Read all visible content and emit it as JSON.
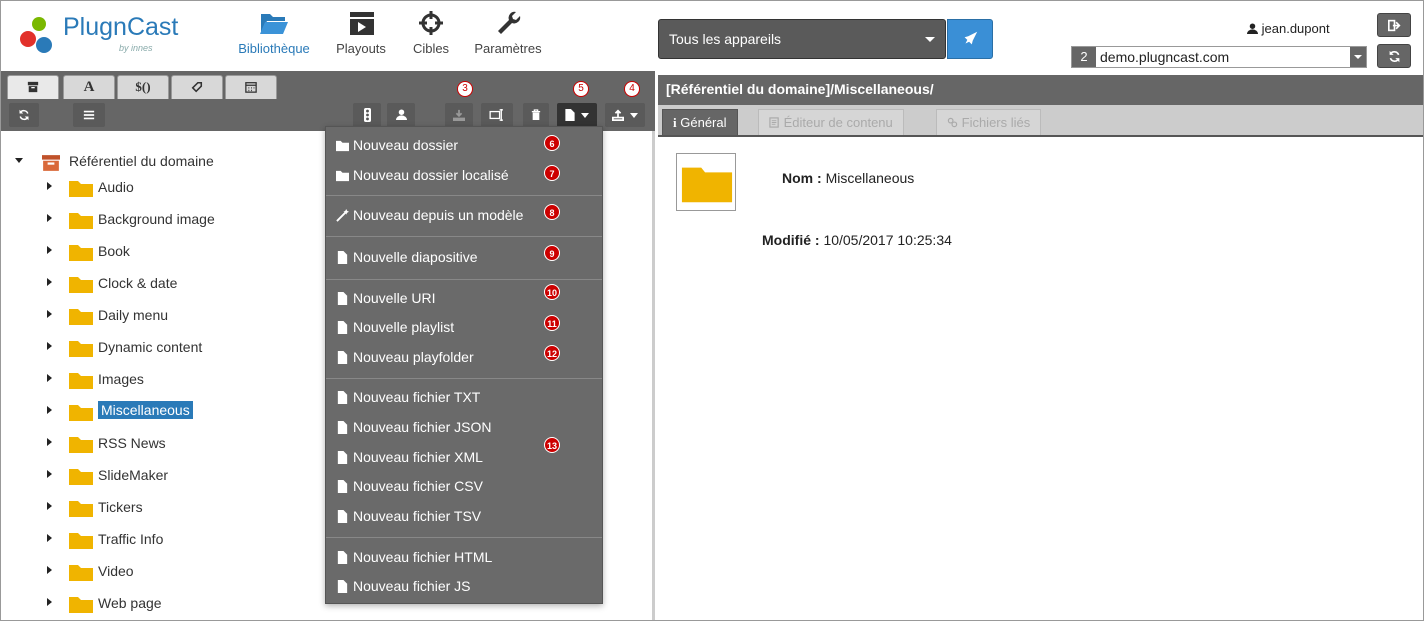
{
  "header": {
    "logo_name": "PlugnCast",
    "logo_by": "by innes",
    "nav": [
      {
        "label": "Bibliothèque",
        "icon": "folder-open-icon",
        "active": true
      },
      {
        "label": "Playouts",
        "icon": "clapperboard-icon",
        "active": false
      },
      {
        "label": "Cibles",
        "icon": "crosshair-icon",
        "active": false
      },
      {
        "label": "Paramètres",
        "icon": "wrench-icon",
        "active": false
      }
    ],
    "device_select": "Tous les appareils",
    "user": "jean.dupont",
    "domain_number": "2",
    "domain_value": "demo.plugncast.com"
  },
  "left": {
    "tabs": [
      {
        "label": "",
        "icon": "archive-icon"
      },
      {
        "label": "A",
        "icon": "font-icon"
      },
      {
        "label": "$()",
        "icon": "variable-icon"
      },
      {
        "label": "",
        "icon": "tag-icon"
      },
      {
        "label": "",
        "icon": "calendar-icon"
      }
    ],
    "markers": [
      "3",
      "5",
      "4"
    ],
    "tree_root": "Référentiel du domaine",
    "tree_items": [
      "Audio",
      "Background image",
      "Book",
      "Clock & date",
      "Daily menu",
      "Dynamic content",
      "Images",
      "Miscellaneous",
      "RSS News",
      "SlideMaker",
      "Tickers",
      "Traffic Info",
      "Video",
      "Web page"
    ],
    "selected_item": "Miscellaneous"
  },
  "menu": {
    "items": [
      {
        "label": "Nouveau dossier",
        "icon": "folder-icon",
        "marker": "6"
      },
      {
        "label": "Nouveau dossier localisé",
        "icon": "folder-icon",
        "marker": "7"
      },
      {
        "label": "Nouveau depuis un modèle",
        "icon": "magic-wand-icon",
        "marker": "8"
      },
      {
        "label": "Nouvelle diapositive",
        "icon": "file-icon",
        "marker": "9"
      },
      {
        "label": "Nouvelle URI",
        "icon": "file-icon",
        "marker": "10"
      },
      {
        "label": "Nouvelle playlist",
        "icon": "file-icon",
        "marker": "11"
      },
      {
        "label": "Nouveau playfolder",
        "icon": "file-icon",
        "marker": "12"
      },
      {
        "label": "Nouveau fichier TXT",
        "icon": "file-icon"
      },
      {
        "label": "Nouveau fichier JSON",
        "icon": "file-icon",
        "marker": "13"
      },
      {
        "label": "Nouveau fichier XML",
        "icon": "file-icon"
      },
      {
        "label": "Nouveau fichier CSV",
        "icon": "file-icon"
      },
      {
        "label": "Nouveau fichier TSV",
        "icon": "file-icon"
      },
      {
        "label": "Nouveau fichier HTML",
        "icon": "file-icon"
      },
      {
        "label": "Nouveau fichier JS",
        "icon": "file-icon"
      }
    ]
  },
  "right": {
    "path": "[Référentiel du domaine]/Miscellaneous/",
    "tabs": [
      {
        "label": "Général",
        "icon": "info-icon"
      },
      {
        "label": "Éditeur de contenu",
        "icon": "edit-icon"
      },
      {
        "label": "Fichiers liés",
        "icon": "link-icon"
      }
    ],
    "name_label": "Nom :",
    "name_value": "Miscellaneous",
    "modified_label": "Modifié :",
    "modified_value": "10/05/2017 10:25:34"
  },
  "colors": {
    "accent": "#2a7ab8",
    "folder": "#f0b400",
    "toolbar": "#666666",
    "marker": "#cc0000"
  }
}
